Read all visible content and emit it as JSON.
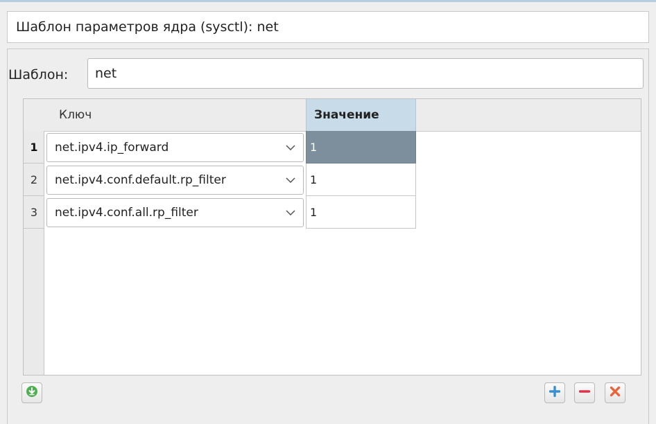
{
  "dialog": {
    "title": "Шаблон параметров ядра (sysctl): net"
  },
  "template": {
    "label": "Шаблон:",
    "value": "net"
  },
  "table": {
    "columns": [
      "Ключ",
      "Значение"
    ],
    "rows": [
      {
        "num": "1",
        "key": "net.ipv4.ip_forward",
        "value": "1"
      },
      {
        "num": "2",
        "key": "net.ipv4.conf.default.rp_filter",
        "value": "1"
      },
      {
        "num": "3",
        "key": "net.ipv4.conf.all.rp_filter",
        "value": "1"
      }
    ]
  },
  "icons": {
    "import": "download-circle-icon",
    "add": "plus-icon",
    "remove": "minus-icon",
    "clear": "delete-x-icon"
  },
  "colors": {
    "selected_cell": "#7d8e9c",
    "header_highlight": "#c7dbe8",
    "add": "#3a8fd0",
    "remove": "#e0334a",
    "clear": "#e8643a",
    "import": "#4caf50"
  }
}
